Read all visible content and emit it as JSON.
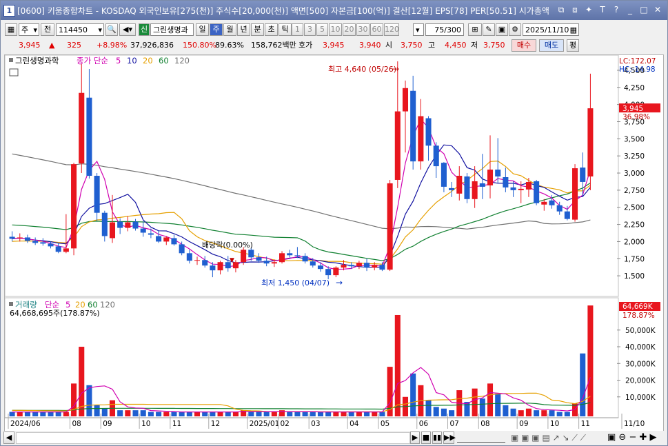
{
  "window": {
    "num": "1",
    "title": "[0600] 키움종합차트 - KOSDAQ 외국인보유[275(천)] 주식수[20,000(천)] 액면[500] 자본금[100(억)] 결산[12월] EPS[78] PER[50.51] 시가총액",
    "icons": [
      "restore-icon",
      "link-icon",
      "pin-icon",
      "text-icon",
      "help-icon",
      "minimize-icon",
      "maximize-icon",
      "close-icon"
    ],
    "glyphs": [
      "⧉",
      "⧈",
      "✦",
      "T",
      "?",
      "_",
      "□",
      "✕"
    ]
  },
  "toolbar": {
    "period_select": "주",
    "prev_label": "전",
    "code": "114450",
    "shin_label": "신",
    "stock_name": "그린생명과",
    "period_tabs": [
      "일",
      "주",
      "월",
      "년",
      "분",
      "초",
      "틱"
    ],
    "selected_period": "주",
    "number_tabs": [
      "1",
      "3",
      "5",
      "10",
      "20",
      "30",
      "60",
      "120"
    ],
    "count_value": "75",
    "count_total": "/300",
    "date_value": "2025/11/10"
  },
  "quote": {
    "price": "3,945",
    "arrow": "▲",
    "change": "325",
    "change_pct": "+8.98%",
    "volume": "37,926,836",
    "vol_ratio": "150.80%",
    "turnover": "89.63%",
    "amount": "158,762백만",
    "hoga_label": "호가",
    "hoga_ask": "3,945",
    "hoga_bid": "3,940",
    "open_label": "시",
    "open": "3,750",
    "high_label": "고",
    "high": "4,450",
    "low_label": "저",
    "low": "3,750",
    "buy_label": "매수",
    "sell_label": "매도",
    "pyeong_label": "평"
  },
  "chart_legend": {
    "name": "그린생명과학",
    "ma_label": "종가 단순",
    "ma_periods": [
      "5",
      "10",
      "20",
      "60",
      "120"
    ],
    "vol_name": "거래량",
    "vol_ma_label": "단순",
    "vol_value": "64,668,695주(178.87%)"
  },
  "annotations": {
    "high": "최고 4,640 (05/26)",
    "low": "최저 1,450 (04/07)",
    "dividend": "배당락(0.00%)",
    "lc": "LC:172.07",
    "hc": "HC:-14.98",
    "last_price": "3,945",
    "last_pct": "36.98%",
    "last_vol": "64,669K",
    "last_vol_pct": "178.87%"
  },
  "colors": {
    "up": "#e8161e",
    "down": "#1f5fd0",
    "ma5": "#d000b0",
    "ma10": "#1010a0",
    "ma20": "#e6a000",
    "ma60": "#108030",
    "ma120": "#707070",
    "title_bar": "#6b7fb0"
  },
  "chart_data": {
    "type": "candlestick",
    "price_axis": {
      "min": 1300,
      "max": 4600,
      "ticks": [
        "4,500",
        "4,250",
        "4,000",
        "3,750",
        "3,500",
        "3,250",
        "3,000",
        "2,750",
        "2,500",
        "2,250",
        "2,000",
        "1,750",
        "1,500"
      ]
    },
    "volume_axis": {
      "ticks": [
        "50,000K",
        "40,000K",
        "30,000K",
        "20,000K",
        "10,000K"
      ]
    },
    "x_labels": [
      "2024/06",
      "08",
      "09",
      "10",
      "11",
      "12",
      "2025/01",
      "02",
      "03",
      "04",
      "05",
      "06",
      "07",
      "08",
      "09",
      "10",
      "11",
      "11/10"
    ],
    "candles": [
      {
        "o": 2070,
        "h": 2150,
        "l": 2000,
        "c": 2040
      },
      {
        "o": 2050,
        "h": 2120,
        "l": 2000,
        "c": 2060
      },
      {
        "o": 2060,
        "h": 2100,
        "l": 1980,
        "c": 2010
      },
      {
        "o": 2010,
        "h": 2060,
        "l": 1950,
        "c": 1980
      },
      {
        "o": 1990,
        "h": 2050,
        "l": 1940,
        "c": 1970
      },
      {
        "o": 1970,
        "h": 2000,
        "l": 1900,
        "c": 1930
      },
      {
        "o": 1930,
        "h": 1980,
        "l": 1830,
        "c": 1850
      },
      {
        "o": 1850,
        "h": 2400,
        "l": 1830,
        "c": 1900
      },
      {
        "o": 1900,
        "h": 3150,
        "l": 1800,
        "c": 3130
      },
      {
        "o": 3140,
        "h": 4600,
        "l": 3000,
        "c": 4170
      },
      {
        "o": 4100,
        "h": 4520,
        "l": 2920,
        "c": 2960
      },
      {
        "o": 2960,
        "h": 3000,
        "l": 2300,
        "c": 2420
      },
      {
        "o": 2420,
        "h": 2450,
        "l": 2000,
        "c": 2080
      },
      {
        "o": 2050,
        "h": 2680,
        "l": 1980,
        "c": 2280
      },
      {
        "o": 2290,
        "h": 2340,
        "l": 2110,
        "c": 2200
      },
      {
        "o": 2200,
        "h": 2370,
        "l": 2150,
        "c": 2280
      },
      {
        "o": 2290,
        "h": 2330,
        "l": 2160,
        "c": 2190
      },
      {
        "o": 2190,
        "h": 2300,
        "l": 2070,
        "c": 2130
      },
      {
        "o": 2120,
        "h": 2190,
        "l": 2050,
        "c": 2100
      },
      {
        "o": 2080,
        "h": 2160,
        "l": 1980,
        "c": 2000
      },
      {
        "o": 2000,
        "h": 2080,
        "l": 1950,
        "c": 2060
      },
      {
        "o": 2050,
        "h": 2100,
        "l": 1940,
        "c": 1960
      },
      {
        "o": 1960,
        "h": 2000,
        "l": 1800,
        "c": 1830
      },
      {
        "o": 1830,
        "h": 1880,
        "l": 1680,
        "c": 1720
      },
      {
        "o": 1720,
        "h": 1780,
        "l": 1660,
        "c": 1730
      },
      {
        "o": 1730,
        "h": 1790,
        "l": 1620,
        "c": 1650
      },
      {
        "o": 1650,
        "h": 1700,
        "l": 1480,
        "c": 1580
      },
      {
        "o": 1580,
        "h": 1720,
        "l": 1520,
        "c": 1700
      },
      {
        "o": 1700,
        "h": 1790,
        "l": 1560,
        "c": 1610
      },
      {
        "o": 1610,
        "h": 1730,
        "l": 1550,
        "c": 1700
      },
      {
        "o": 1700,
        "h": 1920,
        "l": 1660,
        "c": 1880
      },
      {
        "o": 1880,
        "h": 1910,
        "l": 1720,
        "c": 1770
      },
      {
        "o": 1770,
        "h": 1830,
        "l": 1690,
        "c": 1720
      },
      {
        "o": 1720,
        "h": 1780,
        "l": 1640,
        "c": 1680
      },
      {
        "o": 1680,
        "h": 1740,
        "l": 1630,
        "c": 1700
      },
      {
        "o": 1700,
        "h": 1860,
        "l": 1680,
        "c": 1830
      },
      {
        "o": 1830,
        "h": 1880,
        "l": 1770,
        "c": 1800
      },
      {
        "o": 1800,
        "h": 1920,
        "l": 1760,
        "c": 1790
      },
      {
        "o": 1790,
        "h": 1830,
        "l": 1680,
        "c": 1710
      },
      {
        "o": 1710,
        "h": 1760,
        "l": 1620,
        "c": 1650
      },
      {
        "o": 1650,
        "h": 1700,
        "l": 1560,
        "c": 1600
      },
      {
        "o": 1600,
        "h": 1640,
        "l": 1450,
        "c": 1510
      },
      {
        "o": 1510,
        "h": 1640,
        "l": 1480,
        "c": 1620
      },
      {
        "o": 1620,
        "h": 1730,
        "l": 1580,
        "c": 1660
      },
      {
        "o": 1660,
        "h": 1700,
        "l": 1600,
        "c": 1640
      },
      {
        "o": 1640,
        "h": 1720,
        "l": 1600,
        "c": 1690
      },
      {
        "o": 1690,
        "h": 1750,
        "l": 1570,
        "c": 1620
      },
      {
        "o": 1620,
        "h": 1700,
        "l": 1580,
        "c": 1660
      },
      {
        "o": 1660,
        "h": 1700,
        "l": 1570,
        "c": 1590
      },
      {
        "o": 1590,
        "h": 2900,
        "l": 1570,
        "c": 2850
      },
      {
        "o": 2900,
        "h": 4630,
        "l": 2780,
        "c": 3900
      },
      {
        "o": 3900,
        "h": 4350,
        "l": 3300,
        "c": 4240
      },
      {
        "o": 4200,
        "h": 4420,
        "l": 3050,
        "c": 3170
      },
      {
        "o": 3170,
        "h": 4080,
        "l": 3050,
        "c": 3830
      },
      {
        "o": 3800,
        "h": 3830,
        "l": 3180,
        "c": 3400
      },
      {
        "o": 3400,
        "h": 3450,
        "l": 2930,
        "c": 3100
      },
      {
        "o": 3150,
        "h": 3160,
        "l": 2720,
        "c": 2800
      },
      {
        "o": 2780,
        "h": 2870,
        "l": 2650,
        "c": 2750
      },
      {
        "o": 2700,
        "h": 3100,
        "l": 2600,
        "c": 2960
      },
      {
        "o": 2950,
        "h": 3000,
        "l": 2560,
        "c": 2620
      },
      {
        "o": 2620,
        "h": 3100,
        "l": 2490,
        "c": 2880
      },
      {
        "o": 2850,
        "h": 3280,
        "l": 2620,
        "c": 2800
      },
      {
        "o": 2820,
        "h": 3550,
        "l": 2630,
        "c": 3050
      },
      {
        "o": 3050,
        "h": 3510,
        "l": 2850,
        "c": 2950
      },
      {
        "o": 2940,
        "h": 3080,
        "l": 2720,
        "c": 2790
      },
      {
        "o": 2790,
        "h": 2880,
        "l": 2650,
        "c": 2750
      },
      {
        "o": 2750,
        "h": 2880,
        "l": 2560,
        "c": 2770
      },
      {
        "o": 2760,
        "h": 2930,
        "l": 2650,
        "c": 2870
      },
      {
        "o": 2880,
        "h": 2900,
        "l": 2530,
        "c": 2560
      },
      {
        "o": 2540,
        "h": 2620,
        "l": 2450,
        "c": 2580
      },
      {
        "o": 2600,
        "h": 2680,
        "l": 2480,
        "c": 2530
      },
      {
        "o": 2530,
        "h": 2580,
        "l": 2390,
        "c": 2440
      },
      {
        "o": 2440,
        "h": 2520,
        "l": 2310,
        "c": 2330
      },
      {
        "o": 2320,
        "h": 3130,
        "l": 2290,
        "c": 3070
      },
      {
        "o": 3080,
        "h": 3300,
        "l": 2650,
        "c": 2870
      },
      {
        "o": 2950,
        "h": 4450,
        "l": 2750,
        "c": 3945
      }
    ],
    "volume": [
      1,
      1,
      1,
      1,
      1,
      1,
      1,
      1,
      18,
      40,
      17,
      5,
      3,
      8,
      2,
      2,
      2,
      2,
      1,
      1,
      1,
      1,
      1,
      1,
      1,
      1,
      1,
      1,
      1,
      1,
      2,
      1,
      1,
      1,
      1,
      2,
      1,
      1,
      1,
      1,
      1,
      1,
      1,
      1,
      1,
      1,
      1,
      1,
      1,
      28,
      59,
      10,
      24,
      17,
      8,
      4,
      3,
      2,
      14,
      7,
      15,
      9,
      18,
      12,
      5,
      3,
      2,
      3,
      2,
      2,
      2,
      1,
      1,
      6,
      36,
      64.7
    ]
  }
}
